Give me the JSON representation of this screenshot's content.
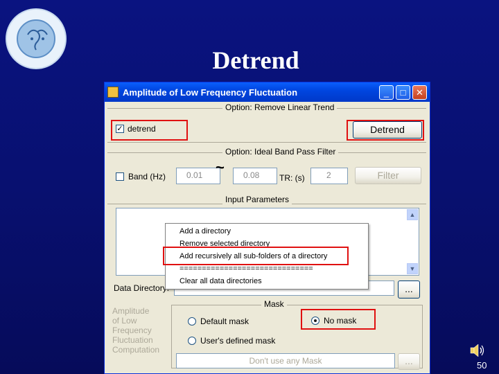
{
  "slide": {
    "title": "Detrend",
    "page_number": "50"
  },
  "window": {
    "title": "Amplitude of Low Frequency Fluctuation",
    "controls": {
      "minimize": "_",
      "maximize": "□",
      "close": "✕"
    }
  },
  "detrend_group": {
    "label": "Option: Remove Linear Trend",
    "checkbox_label": "detrend",
    "checked": true,
    "button": "Detrend"
  },
  "filter_group": {
    "label": "Option: Ideal Band Pass Filter",
    "band_label": "Band (Hz)",
    "band_low": "0.01",
    "tilde": "~",
    "band_high": "0.08",
    "tr_label": "TR: (s)",
    "tr_value": "2",
    "button": "Filter"
  },
  "input_group": {
    "label": "Input Parameters",
    "data_dir_label": "Data Directory:",
    "browse_button": "..."
  },
  "context_menu": {
    "items": [
      "Add a directory",
      "Remove selected directory",
      "Add recursively all sub-folders of a directory",
      "==============================",
      "Clear all data directories"
    ]
  },
  "mask_group": {
    "label": "Mask",
    "options": [
      "Default mask",
      "No mask",
      "User's defined mask"
    ],
    "selected": "No mask",
    "mask_field": "Don't use any Mask",
    "browse_button": "..."
  },
  "side_label": {
    "lines": [
      "Amplitude",
      "of Low",
      "Frequency",
      "Fluctuation",
      "Computation"
    ]
  },
  "colors": {
    "slide_background": "#0a1380",
    "highlight": "#e01010",
    "window_face": "#ece9d8",
    "titlebar": "#0046e0"
  }
}
